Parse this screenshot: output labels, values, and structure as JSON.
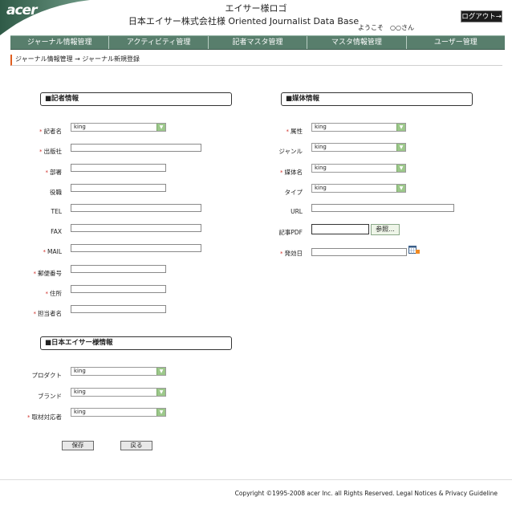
{
  "header": {
    "logo_text": "acer",
    "title_line1": "エイサー様ロゴ",
    "title_line2": "日本エイサー株式会社様 Oriented Journalist Data Base",
    "welcome": "ようこそ　○○さん",
    "logout_label": "ログアウト→"
  },
  "nav": {
    "items": [
      "ジャーナル情報管理",
      "アクティビティ管理",
      "記者マスタ管理",
      "マスタ情報管理",
      "ユーザー管理"
    ]
  },
  "breadcrumb": "ジャーナル情報管理 → ジャーナル新規登録",
  "reporter": {
    "title": "■記者情報",
    "fields": [
      {
        "label": "記者名",
        "required": true,
        "type": "select",
        "value": "king"
      },
      {
        "label": "出版社",
        "required": true,
        "type": "text",
        "value": ""
      },
      {
        "label": "部署",
        "required": true,
        "type": "text",
        "value": ""
      },
      {
        "label": "役職",
        "required": false,
        "type": "text",
        "value": ""
      },
      {
        "label": "TEL",
        "required": false,
        "type": "text",
        "value": ""
      },
      {
        "label": "FAX",
        "required": false,
        "type": "text",
        "value": ""
      },
      {
        "label": "MAIL",
        "required": true,
        "type": "text",
        "value": ""
      },
      {
        "label": "郵便番号",
        "required": true,
        "type": "text",
        "value": ""
      },
      {
        "label": "住所",
        "required": true,
        "type": "text",
        "value": ""
      },
      {
        "label": "担当者名",
        "required": true,
        "type": "text",
        "value": ""
      }
    ]
  },
  "media": {
    "title": "■媒体情報",
    "fields": [
      {
        "label": "属性",
        "required": true,
        "type": "select",
        "value": "king"
      },
      {
        "label": "ジャンル",
        "required": false,
        "type": "select",
        "value": "king"
      },
      {
        "label": "媒体名",
        "required": true,
        "type": "select",
        "value": "king"
      },
      {
        "label": "タイプ",
        "required": false,
        "type": "select",
        "value": "king"
      },
      {
        "label": "URL",
        "required": false,
        "type": "text",
        "value": ""
      },
      {
        "label": "記事PDF",
        "required": false,
        "type": "file",
        "value": "",
        "browse_label": "参照..."
      },
      {
        "label": "発効日",
        "required": true,
        "type": "date",
        "value": ""
      }
    ]
  },
  "acer_info": {
    "title": "■日本エイサー様情報",
    "fields": [
      {
        "label": "プロダクト",
        "required": false,
        "type": "select",
        "value": "king"
      },
      {
        "label": "ブランド",
        "required": false,
        "type": "select",
        "value": "king"
      },
      {
        "label": "取材対応者",
        "required": true,
        "type": "select",
        "value": "king"
      }
    ]
  },
  "actions": {
    "save": "保存",
    "back": "戻る"
  },
  "required_mark": "*",
  "footer": "Copyright ©1995-2008 acer Inc. all Rights Reserved. Legal Notices & Privacy Guideline",
  "colors": {
    "nav": "#587e6c",
    "logo": "#3f6b58",
    "required": "#d0302a",
    "select_arrow": "#9cc88a"
  }
}
